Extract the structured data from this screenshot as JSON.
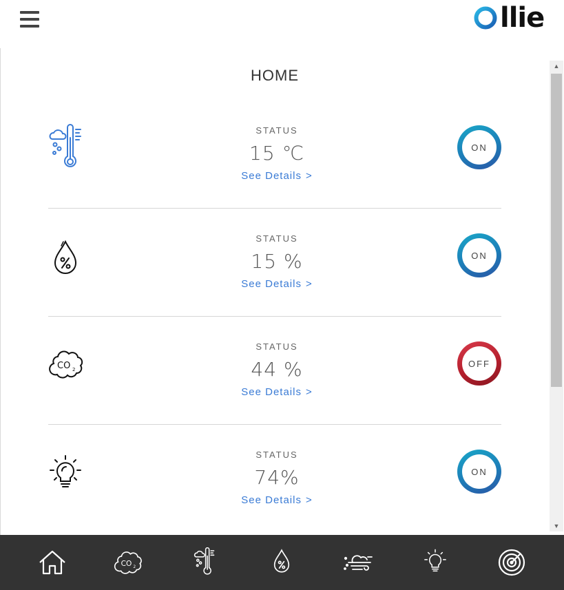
{
  "header": {
    "menu_icon": "hamburger-menu-icon",
    "logo_text": "llie"
  },
  "page_title": "HOME",
  "cards": [
    {
      "icon": "thermometer-weather-icon",
      "status_label": "STATUS",
      "value": "15 ℃",
      "details_label": "See Details",
      "details_chevron": ">",
      "toggle_label": "ON",
      "toggle_state": "on"
    },
    {
      "icon": "humidity-drop-icon",
      "status_label": "STATUS",
      "value": "15 %",
      "details_label": "See Details",
      "details_chevron": ">",
      "toggle_label": "ON",
      "toggle_state": "on"
    },
    {
      "icon": "co2-cloud-icon",
      "status_label": "STATUS",
      "value": "44 %",
      "details_label": "See Details",
      "details_chevron": ">",
      "toggle_label": "OFF",
      "toggle_state": "off"
    },
    {
      "icon": "light-bulb-icon",
      "status_label": "STATUS",
      "value": "74%",
      "details_label": "See Details",
      "details_chevron": ">",
      "toggle_label": "ON",
      "toggle_state": "on"
    }
  ],
  "bottom_nav": [
    {
      "icon": "home-icon"
    },
    {
      "icon": "co2-cloud-icon"
    },
    {
      "icon": "thermometer-weather-icon"
    },
    {
      "icon": "humidity-drop-icon"
    },
    {
      "icon": "wind-weather-icon"
    },
    {
      "icon": "light-bulb-icon"
    },
    {
      "icon": "radar-icon"
    }
  ],
  "colors": {
    "accent_blue": "#3a7bd5",
    "toggle_on": "#1d7db8",
    "toggle_off": "#b5202e",
    "nav_background": "#333333"
  }
}
